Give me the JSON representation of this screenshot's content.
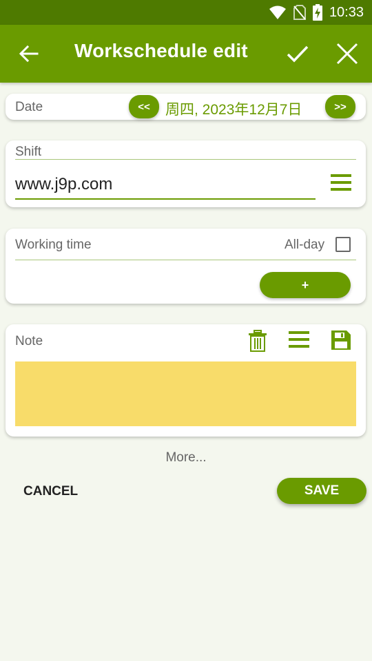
{
  "status_bar": {
    "time": "10:33"
  },
  "app_bar": {
    "title": "Workschedule edit"
  },
  "date_card": {
    "label": "Date",
    "prev_label": "<<",
    "next_label": ">>",
    "value": "周四, 2023年12月7日"
  },
  "shift_card": {
    "label": "Shift",
    "value": "www.j9p.com"
  },
  "working_time_card": {
    "label": "Working time",
    "allday_label": "All-day",
    "allday_checked": false,
    "add_label": "+"
  },
  "note_card": {
    "label": "Note",
    "note_color": "#f8dc6a",
    "text": ""
  },
  "more_label": "More...",
  "cancel_label": "CANCEL",
  "save_label": "SAVE",
  "colors": {
    "accent": "#6a9b00",
    "status_bar": "#4e7a00",
    "background": "#f4f7ee"
  }
}
